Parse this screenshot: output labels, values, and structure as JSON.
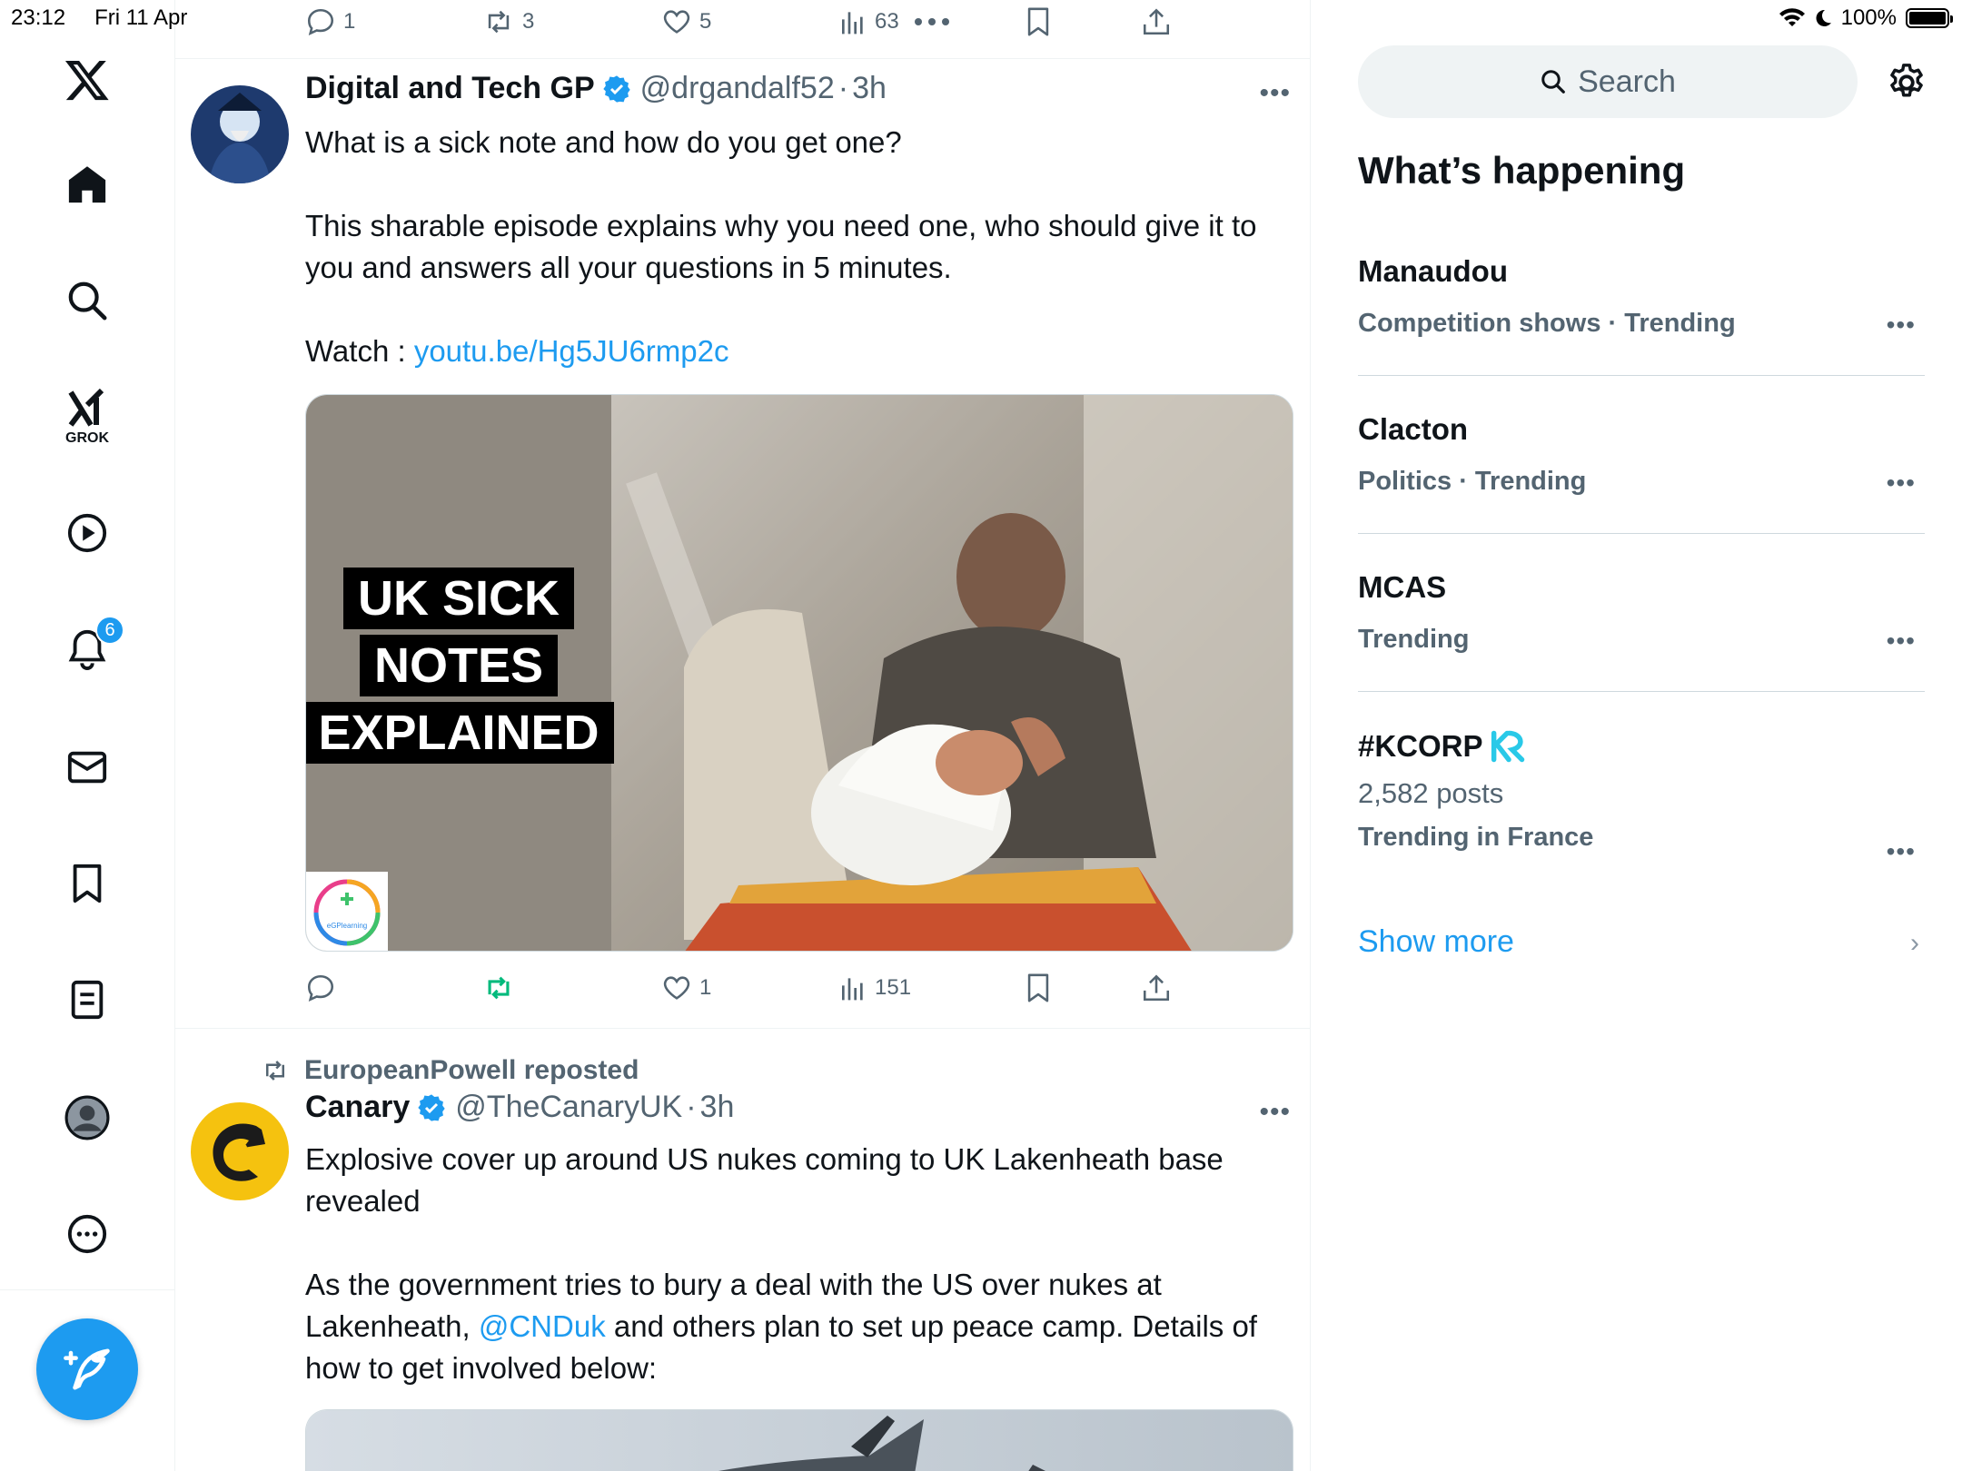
{
  "status_bar": {
    "time": "23:12",
    "date": "Fri 11 Apr",
    "battery": "100%",
    "battery_level": 1.0
  },
  "nav": {
    "items": [
      {
        "name": "x-logo",
        "label": "X"
      },
      {
        "name": "home",
        "label": "Home"
      },
      {
        "name": "explore",
        "label": "Explore"
      },
      {
        "name": "grok",
        "label": "GROK"
      },
      {
        "name": "video",
        "label": "Video"
      },
      {
        "name": "notifications",
        "label": "Notifications"
      },
      {
        "name": "messages",
        "label": "Messages"
      },
      {
        "name": "bookmarks",
        "label": "Bookmarks"
      },
      {
        "name": "lists",
        "label": "Lists"
      },
      {
        "name": "profile",
        "label": "Profile"
      },
      {
        "name": "more",
        "label": "More"
      }
    ],
    "grok_label": "GROK",
    "notifications_badge": "6",
    "accent": "#1d9bf0"
  },
  "feed": {
    "top_actions": {
      "replies": "1",
      "reposts": "3",
      "likes": "5",
      "views": "63"
    },
    "tweets": [
      {
        "name": "Digital and Tech GP",
        "handle": "@drgandalf52",
        "time": "3h",
        "dot": "·",
        "text_lines": [
          "What is a sick note and how do you get one?",
          "",
          "This sharable episode explains why you need one, who should give it to you and answers all your questions in 5 minutes.",
          ""
        ],
        "watch_prefix": "Watch : ",
        "link": "youtu.be/Hg5JU6rmp2c",
        "media_caption_lines": [
          "UK SICK",
          "NOTES",
          "EXPLAINED"
        ],
        "media_logo_text": "eGPlearning",
        "actions": {
          "replies": "",
          "reposts": "",
          "likes": "1",
          "views": "151"
        },
        "reposted_color": "#00ba7c"
      },
      {
        "repost_by": "EuropeanPowell reposted",
        "name": "Canary",
        "handle": "@TheCanaryUK",
        "time": "3h",
        "dot": "·",
        "text_line1": "Explosive cover up around US nukes coming to UK Lakenheath base revealed",
        "text2_prefix": "As the government tries to bury a deal with the US over nukes at Lakenheath, ",
        "mention": "@CNDuk",
        "text2_suffix": " and others plan to set up peace camp. Details of how to get involved below:"
      }
    ]
  },
  "sidebar": {
    "search_placeholder": "Search",
    "section_title": "What’s happening",
    "trends": [
      {
        "name": "Manaudou",
        "meta": "Competition shows · Trending"
      },
      {
        "name": "Clacton",
        "meta": "Politics · Trending"
      },
      {
        "name": "MCAS",
        "meta": "Trending"
      },
      {
        "name": "#KCORP",
        "posts": "2,582 posts",
        "meta": "Trending in France"
      }
    ],
    "show_more": "Show more",
    "more_glyph": "•••"
  }
}
